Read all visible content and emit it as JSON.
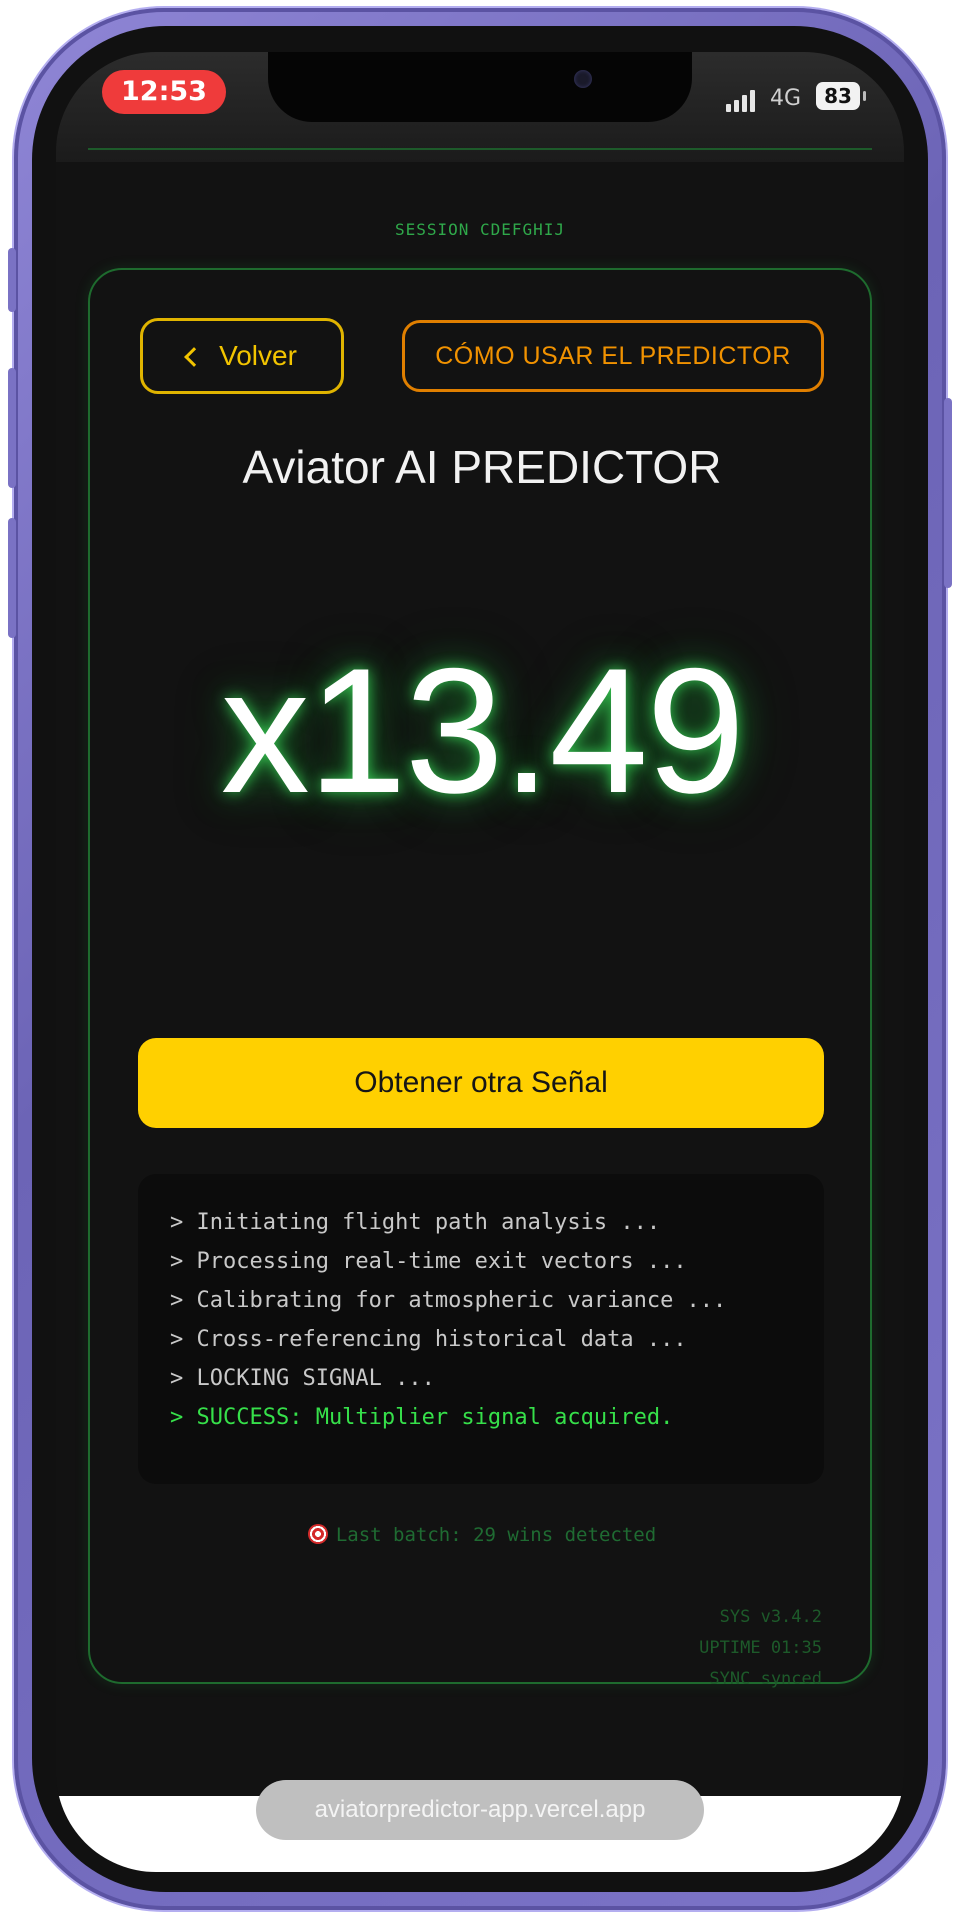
{
  "status_bar": {
    "time": "12:53",
    "network": "4G",
    "battery": "83"
  },
  "session": {
    "label": "SESSION CDEFGHIJ"
  },
  "header": {
    "back_label": "Volver",
    "how_to_label": "CÓMO USAR EL PREDICTOR"
  },
  "title": "Aviator AI PREDICTOR",
  "multiplier": "x13.49",
  "primary_button": {
    "label": "Obtener otra Señal"
  },
  "console": {
    "lines": [
      "> Initiating flight path analysis ...",
      "> Processing real-time exit vectors ...",
      "> Calibrating for atmospheric variance ...",
      "> Cross-referencing historical data ...",
      "> LOCKING SIGNAL ...",
      "> SUCCESS: Multiplier signal acquired."
    ]
  },
  "last_batch": "Last batch: 29 wins detected",
  "sys": {
    "version": "SYS v3.4.2",
    "uptime": "UPTIME 01:35",
    "sync": "SYNC synced"
  },
  "browser": {
    "url": "aviatorpredictor-app.vercel.app"
  },
  "colors": {
    "accent_yellow": "#ffd000",
    "accent_orange": "#f19200",
    "terminal_green": "#36e04a",
    "frame_purple": "#7c74c8"
  }
}
